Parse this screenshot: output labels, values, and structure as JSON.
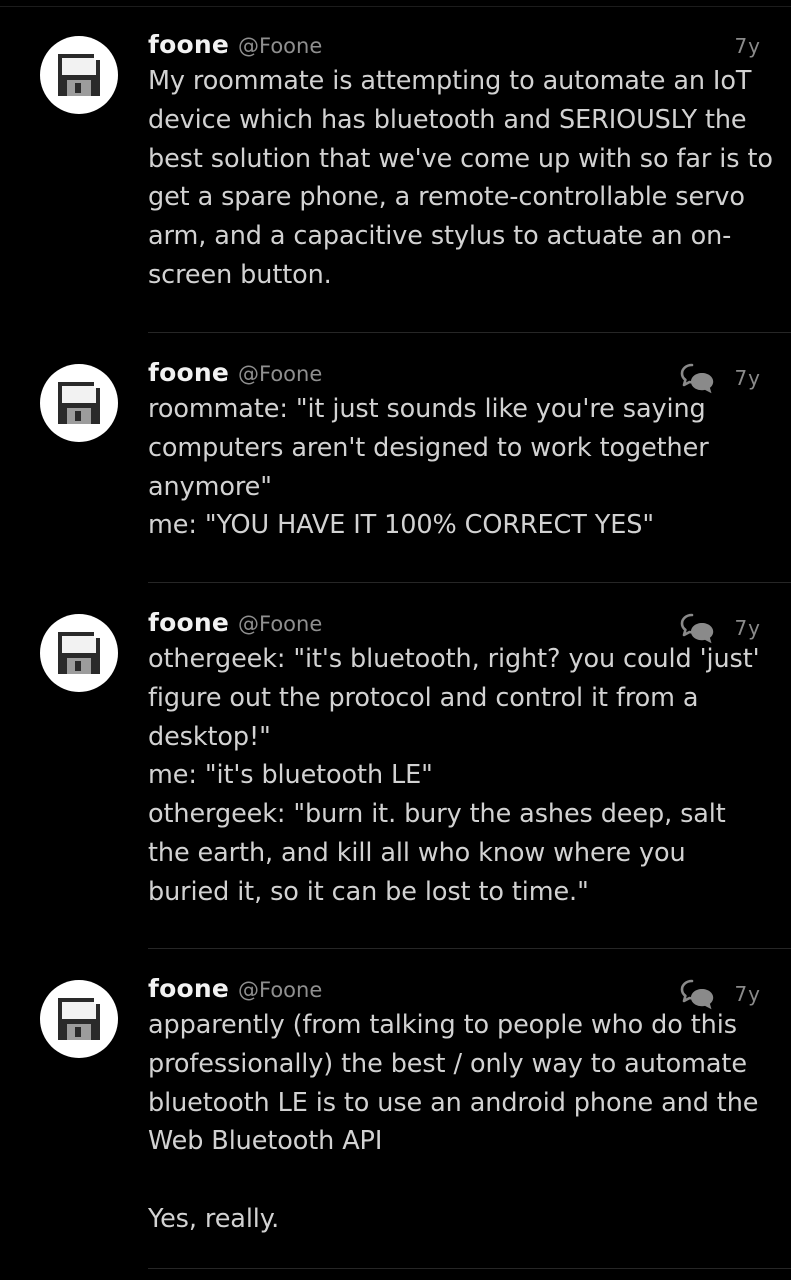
{
  "tweets": [
    {
      "name": "foone",
      "handle": "@Foone",
      "time": "7y",
      "has_reply_icon": false,
      "text": "My roommate is attempting to automate an IoT device which has bluetooth and SERIOUSLY the best solution that we've come up with so far is to get a spare phone, a remote-controllable servo arm, and a capacitive stylus to actuate an on-screen button."
    },
    {
      "name": "foone",
      "handle": "@Foone",
      "time": "7y",
      "has_reply_icon": true,
      "text": "roommate: \"it just sounds like you're saying computers aren't designed to work together anymore\"\nme: \"YOU HAVE IT 100% CORRECT YES\""
    },
    {
      "name": "foone",
      "handle": "@Foone",
      "time": "7y",
      "has_reply_icon": true,
      "text": "othergeek: \"it's bluetooth, right? you could 'just' figure out the protocol and control it from a desktop!\"\nme: \"it's bluetooth LE\"\nothergeek: \"burn it. bury the ashes deep, salt the earth, and kill all who know where you buried it, so it can be lost to time.\""
    },
    {
      "name": "foone",
      "handle": "@Foone",
      "time": "7y",
      "has_reply_icon": true,
      "text": "apparently (from talking to people who do this professionally) the best / only way to automate bluetooth LE is to use an android phone and the Web Bluetooth API\n\nYes, really."
    }
  ],
  "icons": {
    "avatar": "floppy-disk-icon",
    "reply": "conversation-bubbles-icon"
  },
  "colors": {
    "background": "#000000",
    "name": "#f2f2f2",
    "handle": "#8f8f8f",
    "body": "#d2d2d2",
    "time": "#8a8a8a",
    "divider": "#262626"
  }
}
